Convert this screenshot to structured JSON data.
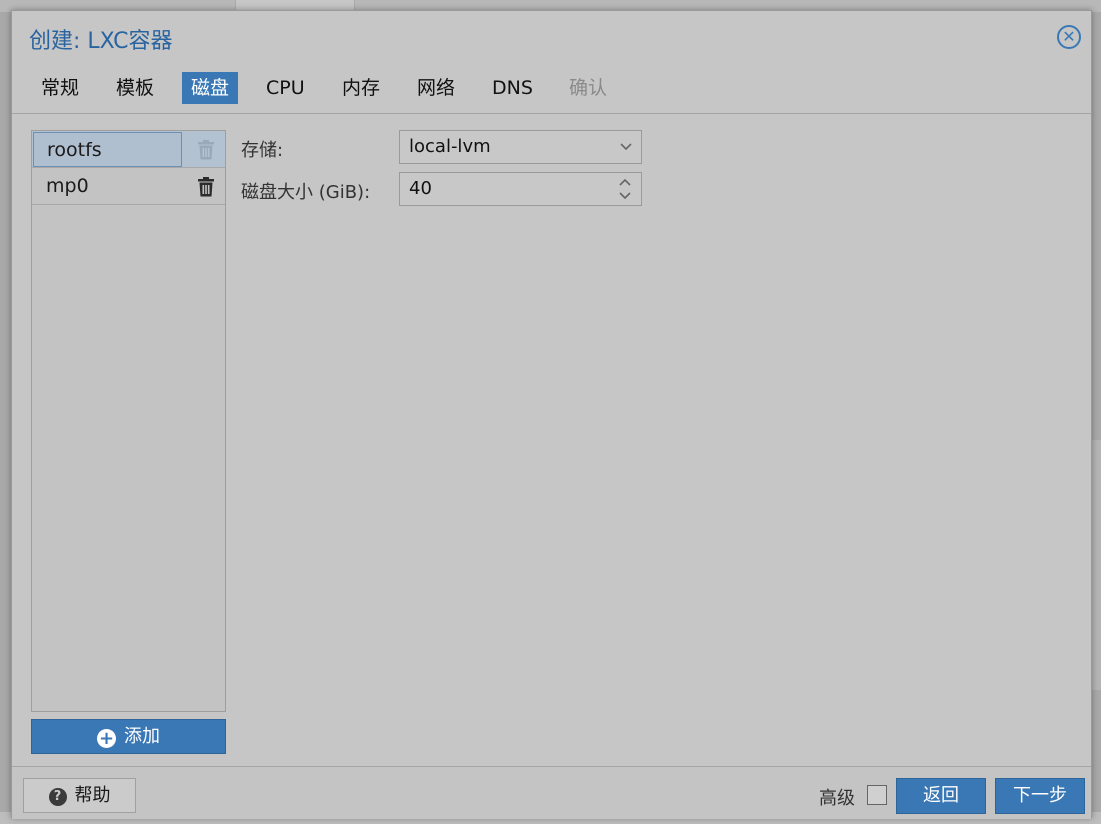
{
  "window": {
    "title": "创建: LXC容器"
  },
  "tabs": [
    {
      "label": "常规"
    },
    {
      "label": "模板"
    },
    {
      "label": "磁盘"
    },
    {
      "label": "CPU"
    },
    {
      "label": "内存"
    },
    {
      "label": "网络"
    },
    {
      "label": "DNS"
    },
    {
      "label": "确认"
    }
  ],
  "active_tab": "磁盘",
  "disks": {
    "items": [
      {
        "name": "rootfs",
        "selected": true
      },
      {
        "name": "mp0",
        "selected": false
      }
    ],
    "add_label": "添加"
  },
  "form": {
    "storage_label": "存储:",
    "storage_value": "local-lvm",
    "size_label": "磁盘大小 (GiB):",
    "size_value": "40"
  },
  "footer": {
    "help_label": "帮助",
    "advanced_label": "高级",
    "advanced_checked": false,
    "back_label": "返回",
    "next_label": "下一步"
  },
  "colors": {
    "accent": "#3a78b5",
    "title": "#2a64a0"
  },
  "icons": [
    "close-icon",
    "trash-icon",
    "plus-icon",
    "help-icon",
    "chevron-down-icon",
    "spinner-icon"
  ]
}
